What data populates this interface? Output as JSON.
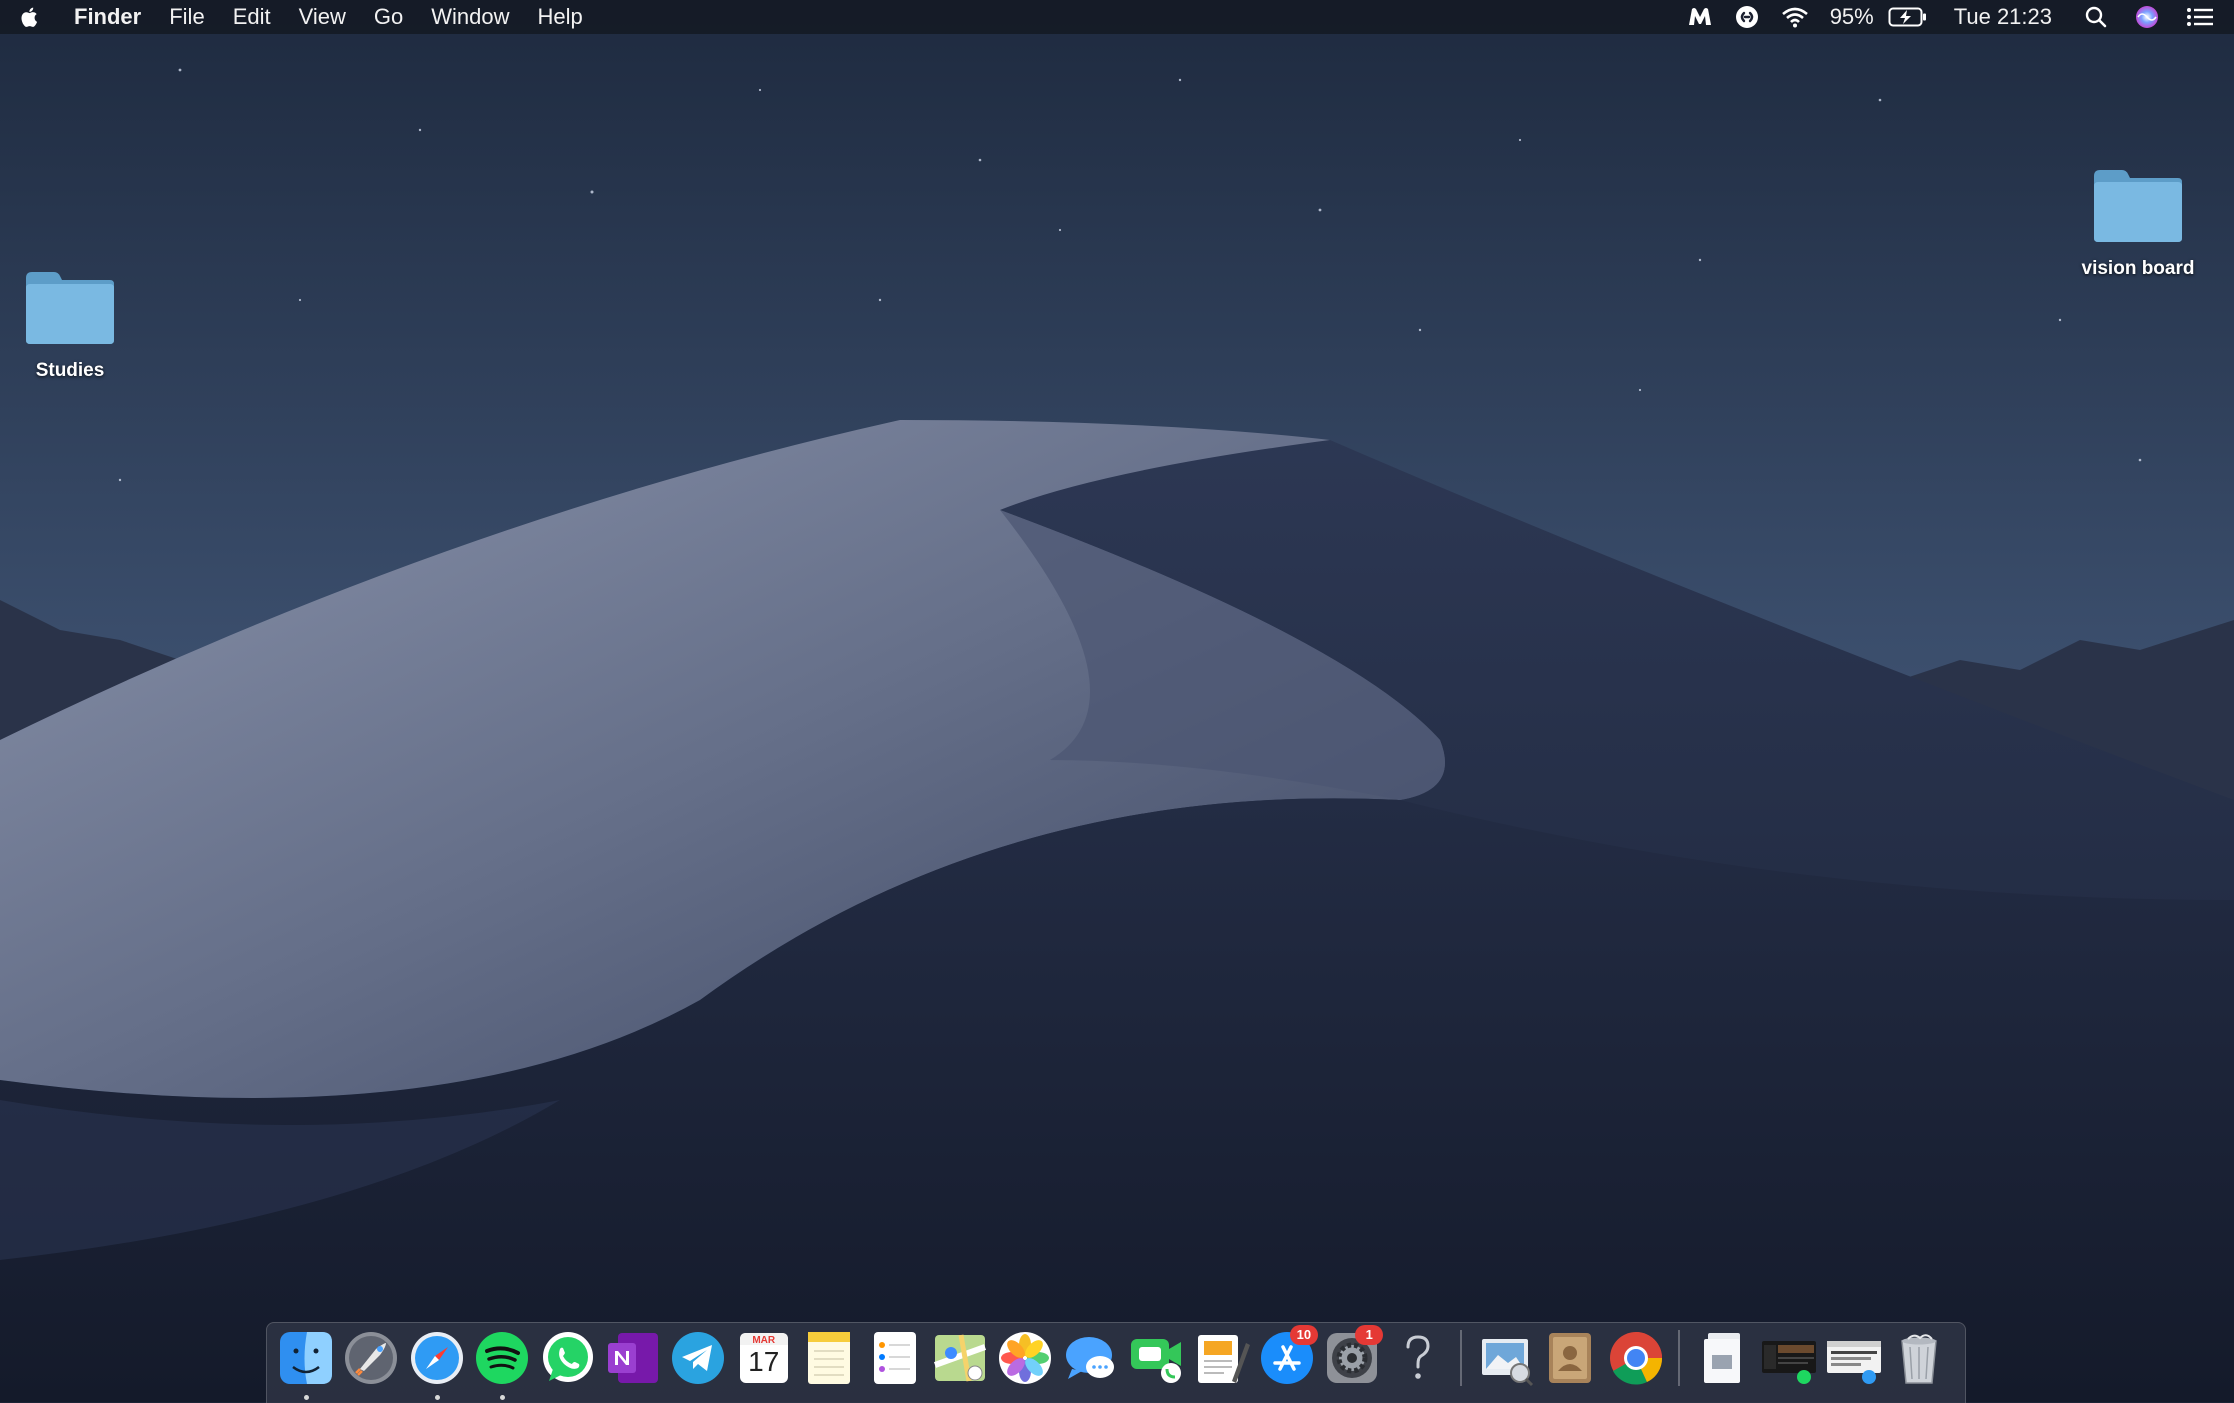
{
  "menubar": {
    "apple_icon": "apple-logo-icon",
    "app_name": "Finder",
    "menus": [
      "File",
      "Edit",
      "View",
      "Go",
      "Window",
      "Help"
    ],
    "status": {
      "icons": [
        "malwarebytes-icon",
        "shazam-icon",
        "wifi-icon"
      ],
      "battery_percent": "95%",
      "battery_state": "charging",
      "clock": "Tue 21:23",
      "right_icons": [
        "spotlight-search-icon",
        "siri-icon",
        "notification-center-icon"
      ]
    }
  },
  "desktop": {
    "folders": [
      {
        "name": "Studies"
      },
      {
        "name": "vision board"
      }
    ]
  },
  "dock": {
    "apps": [
      {
        "name": "Finder",
        "icon": "finder-icon",
        "running": true
      },
      {
        "name": "Launchpad",
        "icon": "launchpad-icon",
        "running": false
      },
      {
        "name": "Safari",
        "icon": "safari-icon",
        "running": true
      },
      {
        "name": "Spotify",
        "icon": "spotify-icon",
        "running": true
      },
      {
        "name": "WhatsApp",
        "icon": "whatsapp-icon",
        "running": false
      },
      {
        "name": "OneNote",
        "icon": "onenote-icon",
        "running": false
      },
      {
        "name": "Telegram",
        "icon": "telegram-icon",
        "running": false
      },
      {
        "name": "Calendar",
        "icon": "calendar-icon",
        "running": false,
        "month": "MAR",
        "day": "17"
      },
      {
        "name": "Notes",
        "icon": "notes-icon",
        "running": false
      },
      {
        "name": "Reminders",
        "icon": "reminders-icon",
        "running": false
      },
      {
        "name": "Maps",
        "icon": "maps-icon",
        "running": false
      },
      {
        "name": "Photos",
        "icon": "photos-icon",
        "running": false
      },
      {
        "name": "Messages",
        "icon": "messages-icon",
        "running": false
      },
      {
        "name": "FaceTime",
        "icon": "facetime-icon",
        "running": false
      },
      {
        "name": "Pages",
        "icon": "pages-icon",
        "running": false
      },
      {
        "name": "App Store",
        "icon": "app-store-icon",
        "running": false,
        "badge": "10"
      },
      {
        "name": "System Preferences",
        "icon": "system-preferences-icon",
        "running": false,
        "badge": "1"
      },
      {
        "name": "Unknown App",
        "icon": "question-mark-icon",
        "running": false
      }
    ],
    "apps2": [
      {
        "name": "Preview",
        "icon": "preview-icon"
      },
      {
        "name": "Contacts",
        "icon": "contacts-icon"
      },
      {
        "name": "Google Chrome",
        "icon": "chrome-icon"
      }
    ],
    "stacks": [
      {
        "name": "Document",
        "icon": "document-stack-icon"
      },
      {
        "name": "Spotify Window",
        "icon": "spotify-window-thumbnail-icon"
      },
      {
        "name": "Safari Window",
        "icon": "safari-window-thumbnail-icon"
      },
      {
        "name": "Trash",
        "icon": "trash-icon"
      }
    ]
  }
}
